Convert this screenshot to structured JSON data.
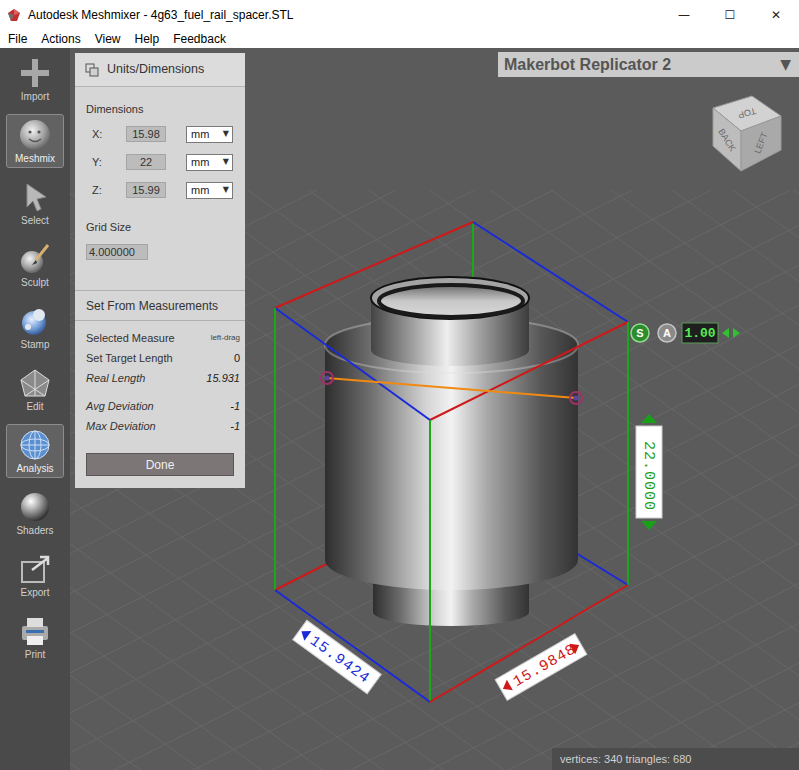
{
  "window": {
    "title": "Autodesk Meshmixer - 4g63_fuel_rail_spacer.STL",
    "controls": [
      "—",
      "☐",
      "✕"
    ]
  },
  "menu": [
    "File",
    "Actions",
    "View",
    "Help",
    "Feedback"
  ],
  "toolbar": [
    {
      "label": "Import",
      "selected": false
    },
    {
      "label": "Meshmix",
      "selected": true
    },
    {
      "label": "Select",
      "selected": false
    },
    {
      "label": "Sculpt",
      "selected": false
    },
    {
      "label": "Stamp",
      "selected": false
    },
    {
      "label": "Edit",
      "selected": false
    },
    {
      "label": "Analysis",
      "selected": true
    },
    {
      "label": "Shaders",
      "selected": false
    },
    {
      "label": "Export",
      "selected": false
    },
    {
      "label": "Print",
      "selected": false
    }
  ],
  "panel": {
    "title": "Units/Dimensions",
    "dimensions_label": "Dimensions",
    "dimensions": [
      {
        "axis": "X:",
        "value": "15.98",
        "unit": "mm"
      },
      {
        "axis": "Y:",
        "value": "22",
        "unit": "mm"
      },
      {
        "axis": "Z:",
        "value": "15.99",
        "unit": "mm"
      }
    ],
    "dropdown_arrow": "▼",
    "grid_size_label": "Grid Size",
    "grid_size": "4.000000",
    "measurements_title": "Set From Measurements",
    "measurements": [
      {
        "label": "Selected Measure",
        "value": "left-drag",
        "readonly": false,
        "kind": "hint"
      },
      {
        "label": "Set Target Length",
        "value": "0",
        "readonly": false,
        "kind": "value"
      },
      {
        "label": "Real Length",
        "value": "15.931",
        "readonly": true,
        "kind": "value"
      },
      {
        "label": "Avg Deviation",
        "value": "-1",
        "readonly": true,
        "kind": "value"
      },
      {
        "label": "Max Deviation",
        "value": "-1",
        "readonly": true,
        "kind": "value"
      }
    ],
    "done": "Done"
  },
  "printer": {
    "label": "Makerbot Replicator 2",
    "arrow": "▼"
  },
  "view_cube": {
    "faces": [
      "TOP",
      "BACK",
      "LEFT"
    ]
  },
  "dimension_labels": [
    {
      "value": "15.9424",
      "color": "#1a2ad8"
    },
    {
      "value": "15.9848",
      "color": "#d01818"
    },
    {
      "value": "22.0000",
      "color": "#18a018"
    }
  ],
  "scale": {
    "toggles": [
      {
        "label": "S",
        "on": true
      },
      {
        "label": "A",
        "on": false
      }
    ],
    "value": "1.00"
  },
  "status_bar": "vertices: 340 triangles: 680"
}
